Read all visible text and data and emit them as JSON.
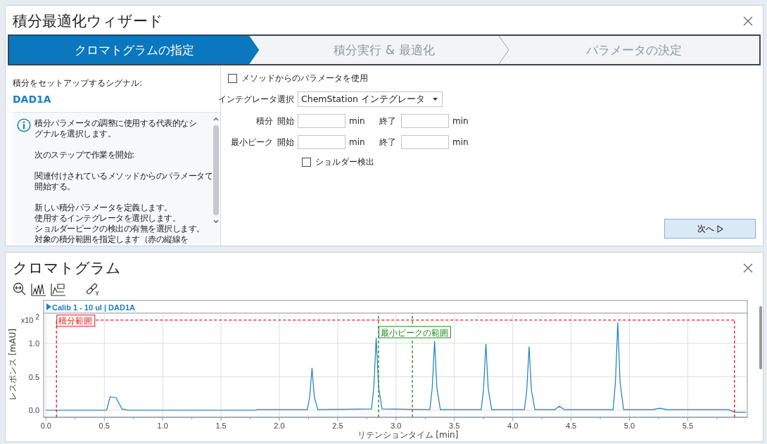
{
  "wizard": {
    "title": "積分最適化ウィザード",
    "steps": [
      {
        "label": "クロマトグラムの指定",
        "selected": true
      },
      {
        "label": "積分実行 & 最適化",
        "selected": false
      },
      {
        "label": "パラメータの決定",
        "selected": false
      }
    ],
    "signal_label": "積分をセットアップするシグナル:",
    "signal": "DAD1A",
    "info": [
      [
        "積分パラメータの調整に使用する代表的なシ",
        "グナルを選択します。"
      ],
      [
        "次のステップで作業を開始:"
      ],
      [
        "関連付けされているメソッドからのパラメータで",
        "開始する。"
      ],
      [
        "新しい積分パラメータを定義します。",
        "使用するインテグレータを選択します。",
        "ショルダーピークの検出の有無を選択します。",
        "対象の積分範囲を指定します（赤の縦線を"
      ]
    ],
    "use_method": {
      "label": "メソッドからのパラメータを使用",
      "checked": false
    },
    "integrator": {
      "label": "インテグレータ選択",
      "value": "ChemStation インテグレータ"
    },
    "ranges": [
      {
        "label": "積分",
        "start_label": "開始",
        "unit1": "min",
        "end_label": "終了",
        "unit2": "min"
      },
      {
        "label": "最小ピーク",
        "start_label": "開始",
        "unit1": "min",
        "end_label": "終了",
        "unit2": "min"
      }
    ],
    "shoulder": {
      "label": "ショルダー検出",
      "checked": false
    },
    "next_button": "次へ"
  },
  "chromatogram": {
    "title": "クロマトグラム",
    "y_multiplier": "x10",
    "y_exponent": "2",
    "chart_data": {
      "type": "line",
      "xlabel": "リテンションタイム [min]",
      "ylabel": "レスポンス [mAU]",
      "xlim": [
        -0.02,
        6.01
      ],
      "ylim": [
        -0.105,
        1.453
      ],
      "grid": true,
      "ref_lines": [
        {
          "axis": "x",
          "value": 0.09,
          "color": "#e8141b",
          "label": "積分範囲"
        },
        {
          "axis": "x",
          "value": 5.9,
          "color": "#e8141b"
        },
        {
          "axis": "y",
          "value": 1.35,
          "color": "#e8141b"
        },
        {
          "axis": "x",
          "value": 2.85,
          "color": "#1a8a1a",
          "label": "最小ピークの範囲"
        },
        {
          "axis": "x",
          "value": 3.14,
          "color": "#1a8a1a"
        }
      ],
      "xticks": [
        {
          "value": 0,
          "label": "0.0"
        },
        {
          "value": 0.5,
          "label": "0.5"
        },
        {
          "value": 1,
          "label": "1.0"
        },
        {
          "value": 1.5,
          "label": "1.5"
        },
        {
          "value": 2,
          "label": "2.0"
        },
        {
          "value": 2.5,
          "label": "2.5"
        },
        {
          "value": 3,
          "label": "3.0"
        },
        {
          "value": 3.5,
          "label": "3.5"
        },
        {
          "value": 4,
          "label": "4.0"
        },
        {
          "value": 4.5,
          "label": "4.5"
        },
        {
          "value": 5,
          "label": "5.0"
        },
        {
          "value": 5.5,
          "label": "5.5"
        }
      ],
      "yticks": [
        {
          "value": 1,
          "label": "1.0"
        },
        {
          "value": 0.5,
          "label": "0.5"
        },
        {
          "value": 0,
          "label": "0.0"
        }
      ],
      "x": [
        0,
        0.52,
        0.55,
        0.6,
        0.65,
        0.68,
        0.7,
        1.8,
        1.81,
        2.24,
        2.26,
        2.28,
        2.3,
        2.33,
        2.79,
        2.81,
        2.83,
        2.85,
        2.88,
        3.29,
        3.31,
        3.33,
        3.35,
        3.38,
        3.73,
        3.75,
        3.77,
        3.79,
        3.82,
        4.1,
        4.12,
        4.14,
        4.16,
        4.19,
        4.36,
        4.4,
        4.44,
        4.86,
        4.88,
        4.9,
        4.92,
        4.95,
        5.2,
        5.26,
        5.32,
        5.85,
        5.9,
        6.0
      ],
      "series": [
        {
          "name": "Calib 1 - 10 ul | DAD1A",
          "color": "#1a7fc4",
          "values": [
            0,
            0,
            0.2,
            0.19,
            0.02,
            0.01,
            0,
            0,
            0.01,
            0.01,
            0.2,
            0.63,
            0.2,
            0.01,
            0.02,
            0.35,
            1.08,
            0.35,
            0.02,
            0.01,
            0.33,
            1.03,
            0.33,
            0.01,
            0.01,
            0.32,
            0.99,
            0.32,
            0.01,
            0.01,
            0.3,
            0.95,
            0.3,
            0.01,
            0.01,
            0.06,
            0.01,
            0.01,
            0.42,
            1.31,
            0.42,
            0.01,
            0.01,
            0.03,
            0.01,
            0.01,
            -0.03,
            -0.03
          ]
        }
      ]
    }
  }
}
